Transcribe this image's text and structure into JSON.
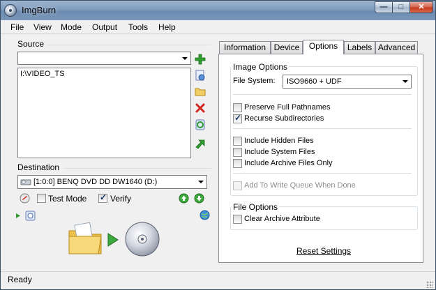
{
  "window": {
    "title": "ImgBurn",
    "minimize": "—",
    "maximize": "□",
    "close": "✕"
  },
  "menu": [
    "File",
    "View",
    "Mode",
    "Output",
    "Tools",
    "Help"
  ],
  "source": {
    "label": "Source",
    "combo_value": "",
    "items": [
      "I:\\VIDEO_TS"
    ],
    "icons": [
      "add-icon",
      "add-file-icon",
      "add-folder-icon",
      "remove-icon",
      "refresh-icon",
      "move-icon"
    ]
  },
  "destination": {
    "label": "Destination",
    "drive": "[1:0:0] BENQ DVD DD DW1640 (D:)",
    "test_mode": {
      "label": "Test Mode",
      "checked": false
    },
    "verify": {
      "label": "Verify",
      "checked": true
    }
  },
  "tabs": [
    "Information",
    "Device",
    "Options",
    "Labels",
    "Advanced"
  ],
  "active_tab": "Options",
  "options": {
    "image_options_legend": "Image Options",
    "file_system_label": "File System:",
    "file_system_value": "ISO9660 + UDF",
    "checkboxes": [
      {
        "label": "Preserve Full Pathnames",
        "checked": false,
        "enabled": true
      },
      {
        "label": "Recurse Subdirectories",
        "checked": true,
        "enabled": true
      },
      {
        "label": "Include Hidden Files",
        "checked": false,
        "enabled": true
      },
      {
        "label": "Include System Files",
        "checked": false,
        "enabled": true
      },
      {
        "label": "Include Archive Files Only",
        "checked": false,
        "enabled": true
      },
      {
        "label": "Add To Write Queue When Done",
        "checked": false,
        "enabled": false
      }
    ],
    "file_options_legend": "File Options",
    "clear_archive": {
      "label": "Clear Archive Attribute",
      "checked": false
    },
    "reset_link": "Reset Settings"
  },
  "status": {
    "text": "Ready"
  },
  "colors": {
    "accent_green": "#2e9c2e",
    "title_blue": "#7f9cbd",
    "close_red": "#c4381c"
  }
}
